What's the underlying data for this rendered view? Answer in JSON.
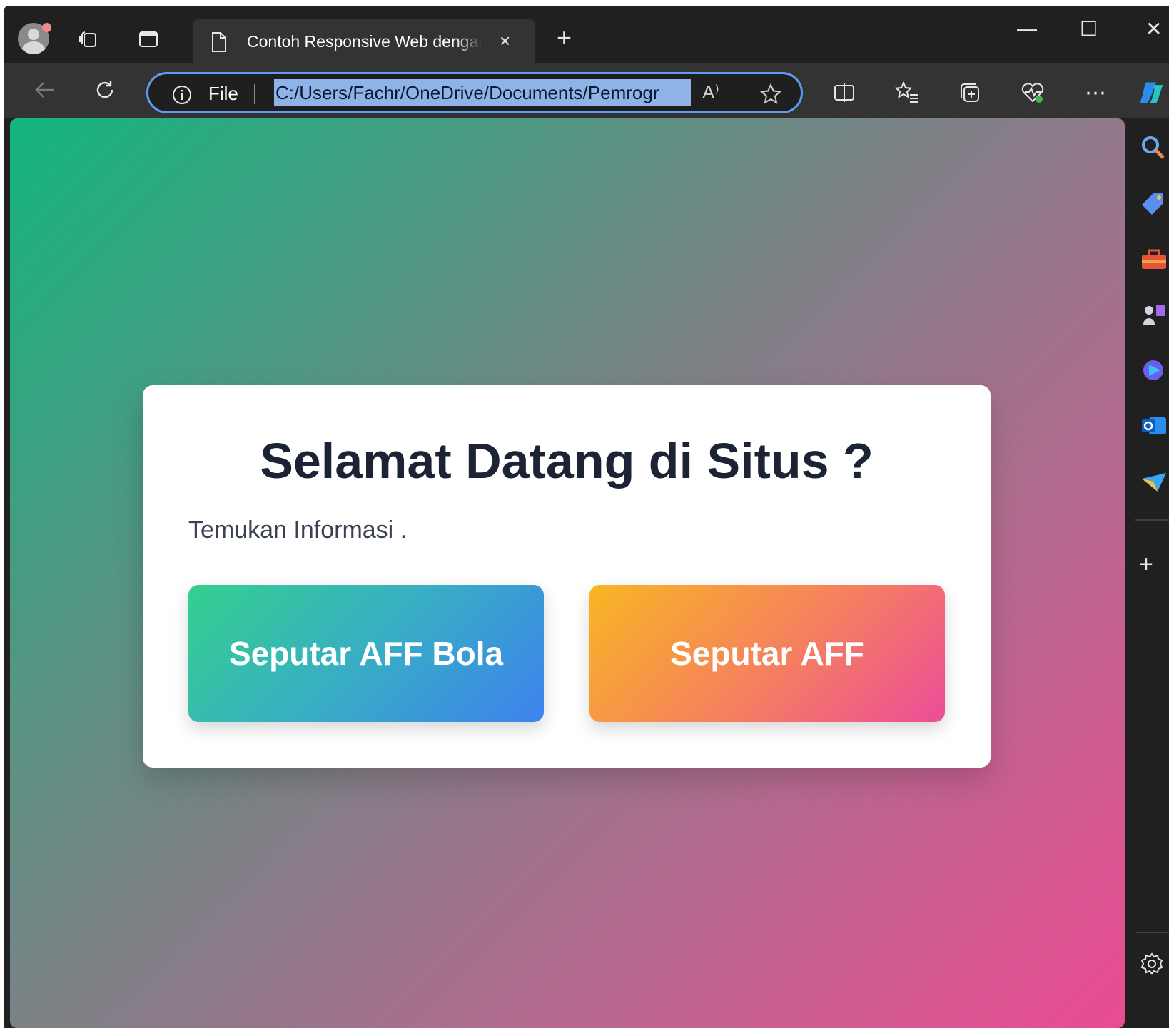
{
  "browser": {
    "tab": {
      "title": "Contoh Responsive Web dengan",
      "close": "×"
    },
    "new_tab": "+",
    "window_controls": {
      "minimize": "—",
      "maximize": "☐",
      "close": "✕"
    },
    "address": {
      "scheme_label": "File",
      "url": "C:/Users/Fachr/OneDrive/Documents/Pemrogr",
      "read_aloud": "A⁾",
      "accent_color": "#5e9cf0"
    },
    "more": "⋯"
  },
  "sidebar": {
    "icons": [
      "search-icon",
      "tag-icon",
      "toolbox-icon",
      "games-icon",
      "copilot-icon",
      "outlook-icon",
      "send-icon"
    ],
    "add": "+"
  },
  "page": {
    "heading": "Selamat Datang di Situs ?",
    "subtitle": "Temukan Informasi .",
    "buttons": [
      {
        "label": "Seputar AFF Bola"
      },
      {
        "label": "Seputar AFF"
      }
    ],
    "colors": {
      "background_start": "#13b57f",
      "background_end": "#ea4c92",
      "button1_start": "#34d08f",
      "button1_end": "#3d82ef",
      "button2_start": "#f8b623",
      "button2_end": "#ec4d98"
    }
  }
}
